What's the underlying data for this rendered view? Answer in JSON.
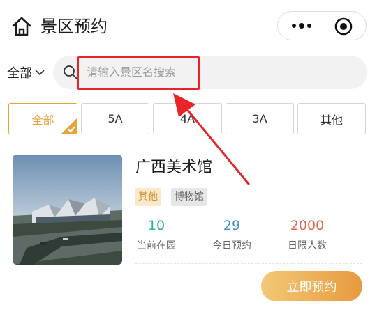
{
  "header": {
    "title": "景区预约",
    "icons": {
      "home": "home-icon",
      "more": "more-dots-icon",
      "close": "target-circle-icon"
    }
  },
  "filter": {
    "category_selected": "全部",
    "category_icon": "chevron-down-icon"
  },
  "search": {
    "placeholder": "请输入景区名搜索",
    "icon": "search-icon"
  },
  "annotation": {
    "highlight_color": "#e8242a",
    "arrow_color": "#e8242a"
  },
  "tabs": [
    {
      "label": "全部",
      "active": true
    },
    {
      "label": "5A",
      "active": false
    },
    {
      "label": "4A",
      "active": false
    },
    {
      "label": "3A",
      "active": false
    },
    {
      "label": "其他",
      "active": false
    }
  ],
  "card": {
    "title": "广西美术馆",
    "tags": [
      "其他",
      "博物馆"
    ],
    "stats": [
      {
        "value": "10",
        "label": "当前在园",
        "color": "#2bb39b"
      },
      {
        "value": "29",
        "label": "今日预约",
        "color": "#3f8fd2"
      },
      {
        "value": "2000",
        "label": "日限人数",
        "color": "#e2674b"
      }
    ],
    "button": "立即预约"
  },
  "colors": {
    "accent": "#e6a23c",
    "button_gradient_start": "#f3c877",
    "button_gradient_end": "#e89a3e"
  }
}
